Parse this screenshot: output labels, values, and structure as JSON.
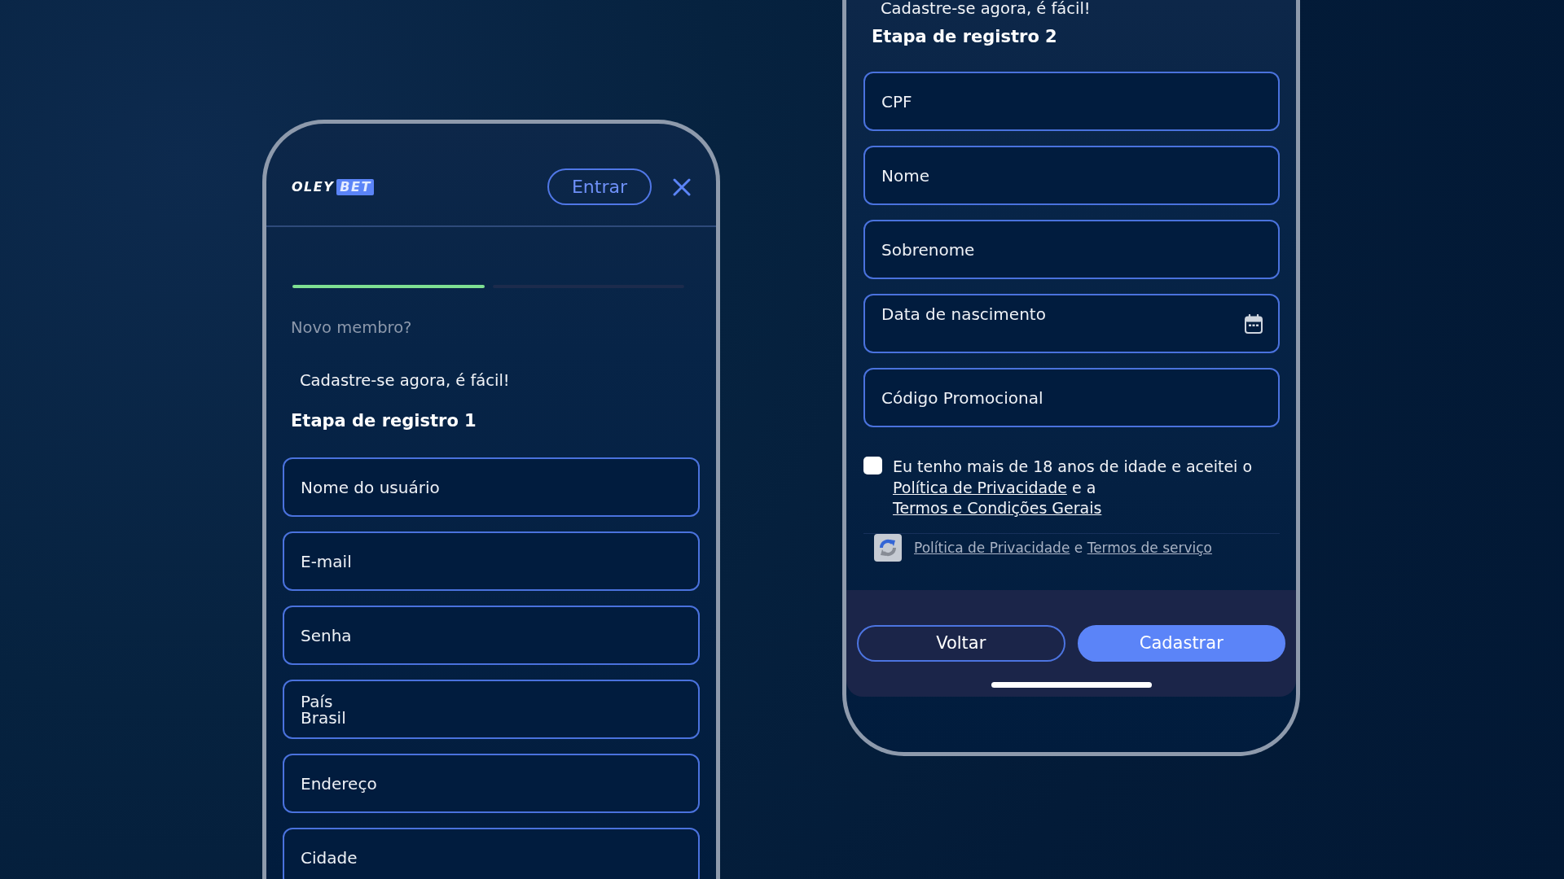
{
  "phone_step_1": {
    "header": {
      "logo": {
        "text": "OLEY",
        "badge": "BET"
      },
      "login_button": "Entrar"
    },
    "progress_steps": [
      {
        "completed": true
      },
      {
        "completed": false
      }
    ],
    "intro": {
      "question": "Novo membro?",
      "tagline": "Cadastre-se agora, é fácil!",
      "title": "Etapa de registro 1"
    },
    "fields": [
      {
        "kind": "text",
        "placeholder": "Nome do usuário"
      },
      {
        "kind": "text",
        "placeholder": "E-mail"
      },
      {
        "kind": "text",
        "placeholder": "Senha"
      },
      {
        "kind": "select",
        "label": "País",
        "value": "Brasil"
      },
      {
        "kind": "text",
        "placeholder": "Endereço"
      },
      {
        "kind": "text",
        "placeholder": "Cidade"
      }
    ]
  },
  "phone_step_2": {
    "intro": {
      "tagline": "Cadastre-se agora, é fácil!",
      "title": "Etapa de registro 2"
    },
    "fields": [
      {
        "kind": "text",
        "placeholder": "CPF"
      },
      {
        "kind": "text",
        "placeholder": "Nome"
      },
      {
        "kind": "text",
        "placeholder": "Sobrenome"
      },
      {
        "kind": "date",
        "placeholder": "Data de nascimento"
      },
      {
        "kind": "text",
        "placeholder": "Código Promocional"
      }
    ],
    "consent": {
      "checked": false,
      "parts": [
        {
          "kind": "text",
          "text": "Eu tenho mais de 18 anos de idade e aceitei o"
        },
        {
          "kind": "link",
          "text": "Política de Privacidade"
        },
        {
          "kind": "text",
          "text": "e a"
        },
        {
          "kind": "link",
          "text": "Termos e Condições Gerais"
        }
      ]
    },
    "recaptcha_notice": {
      "parts": [
        {
          "kind": "link",
          "text": "Política de Privacidade"
        },
        {
          "kind": "text",
          "text": "e"
        },
        {
          "kind": "link",
          "text": "Termos de serviço"
        }
      ]
    },
    "buttons": [
      {
        "kind": "secondary",
        "label": "Voltar"
      },
      {
        "kind": "primary",
        "label": "Cadastrar"
      }
    ]
  }
}
